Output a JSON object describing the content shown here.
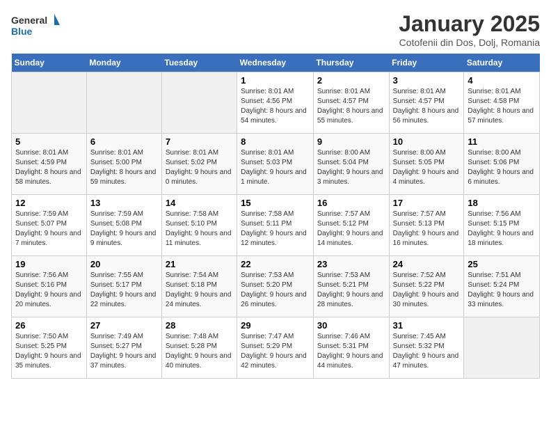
{
  "header": {
    "logo_line1": "General",
    "logo_line2": "Blue",
    "title": "January 2025",
    "subtitle": "Cotofenii din Dos, Dolj, Romania"
  },
  "weekdays": [
    "Sunday",
    "Monday",
    "Tuesday",
    "Wednesday",
    "Thursday",
    "Friday",
    "Saturday"
  ],
  "weeks": [
    [
      {
        "day": "",
        "info": ""
      },
      {
        "day": "",
        "info": ""
      },
      {
        "day": "",
        "info": ""
      },
      {
        "day": "1",
        "info": "Sunrise: 8:01 AM\nSunset: 4:56 PM\nDaylight: 8 hours\nand 54 minutes."
      },
      {
        "day": "2",
        "info": "Sunrise: 8:01 AM\nSunset: 4:57 PM\nDaylight: 8 hours\nand 55 minutes."
      },
      {
        "day": "3",
        "info": "Sunrise: 8:01 AM\nSunset: 4:57 PM\nDaylight: 8 hours\nand 56 minutes."
      },
      {
        "day": "4",
        "info": "Sunrise: 8:01 AM\nSunset: 4:58 PM\nDaylight: 8 hours\nand 57 minutes."
      }
    ],
    [
      {
        "day": "5",
        "info": "Sunrise: 8:01 AM\nSunset: 4:59 PM\nDaylight: 8 hours\nand 58 minutes."
      },
      {
        "day": "6",
        "info": "Sunrise: 8:01 AM\nSunset: 5:00 PM\nDaylight: 8 hours\nand 59 minutes."
      },
      {
        "day": "7",
        "info": "Sunrise: 8:01 AM\nSunset: 5:02 PM\nDaylight: 9 hours\nand 0 minutes."
      },
      {
        "day": "8",
        "info": "Sunrise: 8:01 AM\nSunset: 5:03 PM\nDaylight: 9 hours\nand 1 minute."
      },
      {
        "day": "9",
        "info": "Sunrise: 8:00 AM\nSunset: 5:04 PM\nDaylight: 9 hours\nand 3 minutes."
      },
      {
        "day": "10",
        "info": "Sunrise: 8:00 AM\nSunset: 5:05 PM\nDaylight: 9 hours\nand 4 minutes."
      },
      {
        "day": "11",
        "info": "Sunrise: 8:00 AM\nSunset: 5:06 PM\nDaylight: 9 hours\nand 6 minutes."
      }
    ],
    [
      {
        "day": "12",
        "info": "Sunrise: 7:59 AM\nSunset: 5:07 PM\nDaylight: 9 hours\nand 7 minutes."
      },
      {
        "day": "13",
        "info": "Sunrise: 7:59 AM\nSunset: 5:08 PM\nDaylight: 9 hours\nand 9 minutes."
      },
      {
        "day": "14",
        "info": "Sunrise: 7:58 AM\nSunset: 5:10 PM\nDaylight: 9 hours\nand 11 minutes."
      },
      {
        "day": "15",
        "info": "Sunrise: 7:58 AM\nSunset: 5:11 PM\nDaylight: 9 hours\nand 12 minutes."
      },
      {
        "day": "16",
        "info": "Sunrise: 7:57 AM\nSunset: 5:12 PM\nDaylight: 9 hours\nand 14 minutes."
      },
      {
        "day": "17",
        "info": "Sunrise: 7:57 AM\nSunset: 5:13 PM\nDaylight: 9 hours\nand 16 minutes."
      },
      {
        "day": "18",
        "info": "Sunrise: 7:56 AM\nSunset: 5:15 PM\nDaylight: 9 hours\nand 18 minutes."
      }
    ],
    [
      {
        "day": "19",
        "info": "Sunrise: 7:56 AM\nSunset: 5:16 PM\nDaylight: 9 hours\nand 20 minutes."
      },
      {
        "day": "20",
        "info": "Sunrise: 7:55 AM\nSunset: 5:17 PM\nDaylight: 9 hours\nand 22 minutes."
      },
      {
        "day": "21",
        "info": "Sunrise: 7:54 AM\nSunset: 5:18 PM\nDaylight: 9 hours\nand 24 minutes."
      },
      {
        "day": "22",
        "info": "Sunrise: 7:53 AM\nSunset: 5:20 PM\nDaylight: 9 hours\nand 26 minutes."
      },
      {
        "day": "23",
        "info": "Sunrise: 7:53 AM\nSunset: 5:21 PM\nDaylight: 9 hours\nand 28 minutes."
      },
      {
        "day": "24",
        "info": "Sunrise: 7:52 AM\nSunset: 5:22 PM\nDaylight: 9 hours\nand 30 minutes."
      },
      {
        "day": "25",
        "info": "Sunrise: 7:51 AM\nSunset: 5:24 PM\nDaylight: 9 hours\nand 33 minutes."
      }
    ],
    [
      {
        "day": "26",
        "info": "Sunrise: 7:50 AM\nSunset: 5:25 PM\nDaylight: 9 hours\nand 35 minutes."
      },
      {
        "day": "27",
        "info": "Sunrise: 7:49 AM\nSunset: 5:27 PM\nDaylight: 9 hours\nand 37 minutes."
      },
      {
        "day": "28",
        "info": "Sunrise: 7:48 AM\nSunset: 5:28 PM\nDaylight: 9 hours\nand 40 minutes."
      },
      {
        "day": "29",
        "info": "Sunrise: 7:47 AM\nSunset: 5:29 PM\nDaylight: 9 hours\nand 42 minutes."
      },
      {
        "day": "30",
        "info": "Sunrise: 7:46 AM\nSunset: 5:31 PM\nDaylight: 9 hours\nand 44 minutes."
      },
      {
        "day": "31",
        "info": "Sunrise: 7:45 AM\nSunset: 5:32 PM\nDaylight: 9 hours\nand 47 minutes."
      },
      {
        "day": "",
        "info": ""
      }
    ]
  ]
}
